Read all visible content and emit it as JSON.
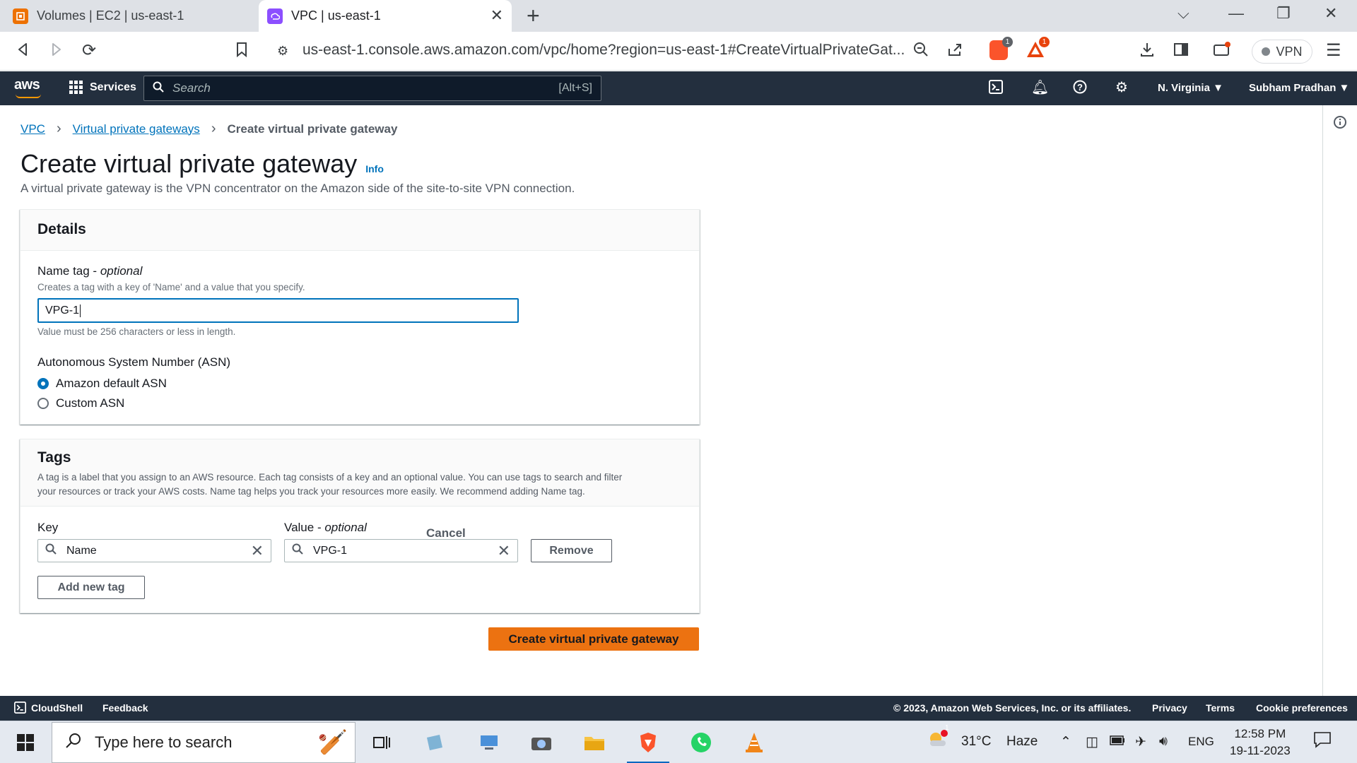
{
  "browser": {
    "tabs": [
      {
        "title": "Volumes | EC2 | us-east-1",
        "active": false,
        "icon": "ec2-icon",
        "icon_color": "#ed7100"
      },
      {
        "title": "VPC | us-east-1",
        "active": true,
        "icon": "vpc-icon",
        "icon_color": "#8c4fff"
      }
    ],
    "url": "us-east-1.console.aws.amazon.com/vpc/home?region=us-east-1#CreateVirtualPrivateGat...",
    "brave_badge": "1",
    "rewards_badge": "1",
    "vpn_label": "VPN"
  },
  "aws_header": {
    "logo": "aws",
    "services_label": "Services",
    "search_placeholder": "Search",
    "search_shortcut": "[Alt+S]",
    "region": "N. Virginia",
    "user": "Subham Pradhan",
    "header_color": "#232f3e"
  },
  "breadcrumb": [
    {
      "label": "VPC",
      "link": true
    },
    {
      "label": "Virtual private gateways",
      "link": true
    },
    {
      "label": "Create virtual private gateway",
      "link": false
    }
  ],
  "page": {
    "title": "Create virtual private gateway",
    "info_link": "Info",
    "description": "A virtual private gateway is the VPN concentrator on the Amazon side of the site-to-site VPN connection."
  },
  "details": {
    "heading": "Details",
    "name_tag_label": "Name tag",
    "name_tag_optional": "optional",
    "name_tag_hint": "Creates a tag with a key of 'Name' and a value that you specify.",
    "name_tag_value": "VPG-1",
    "name_tag_constraint": "Value must be 256 characters or less in length.",
    "asn_label": "Autonomous System Number (ASN)",
    "asn_options": [
      {
        "label": "Amazon default ASN",
        "selected": true
      },
      {
        "label": "Custom ASN",
        "selected": false
      }
    ]
  },
  "tags": {
    "heading": "Tags",
    "description_line1": "A tag is a label that you assign to an AWS resource. Each tag consists of a key and an optional value. You can use tags to search and filter",
    "description_line2": "your resources or track your AWS costs. Name tag helps you track your resources more easily. We recommend adding Name tag.",
    "key_label": "Key",
    "value_label": "Value",
    "value_optional": "optional",
    "rows": [
      {
        "key": "Name",
        "value": "VPG-1"
      }
    ],
    "remove_label": "Remove",
    "add_label": "Add new tag"
  },
  "actions": {
    "cancel": "Cancel",
    "submit": "Create virtual private gateway",
    "submit_color": "#ec7211"
  },
  "footer": {
    "cloudshell": "CloudShell",
    "feedback": "Feedback",
    "copyright": "© 2023, Amazon Web Services, Inc. or its affiliates.",
    "privacy": "Privacy",
    "terms": "Terms",
    "cookies": "Cookie preferences"
  },
  "taskbar": {
    "search_placeholder": "Type here to search",
    "weather_temp": "31°C",
    "weather_desc": "Haze",
    "weather_badge": "1",
    "language": "ENG",
    "time": "12:58 PM",
    "date": "19-11-2023"
  }
}
